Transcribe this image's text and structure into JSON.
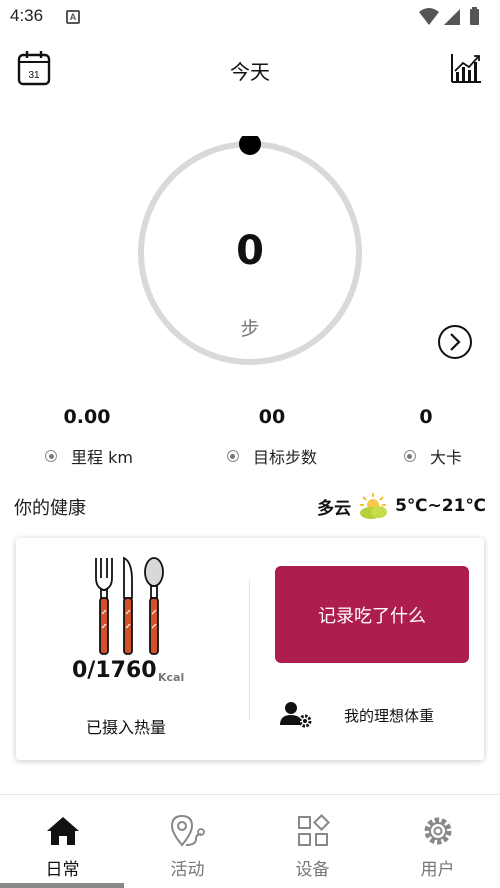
{
  "status_bar": {
    "time": "4:36",
    "notification_letter": "A"
  },
  "header": {
    "title": "今天",
    "calendar_day": "31"
  },
  "steps": {
    "value": "0",
    "unit": "步",
    "progress": 0
  },
  "stats": [
    {
      "value": "0.00",
      "label": "里程 km"
    },
    {
      "value": "00",
      "label": "目标步数"
    },
    {
      "value": "0",
      "label": "大卡"
    }
  ],
  "health": {
    "title": "你的健康"
  },
  "weather": {
    "condition": "多云",
    "temp_range": "5℃~21℃",
    "icon": "partly-cloudy-icon"
  },
  "intake": {
    "value": "0/1760",
    "unit": "Kcal",
    "label": "已摄入热量"
  },
  "actions": {
    "record_label": "记录吃了什么",
    "ideal_weight_label": "我的理想体重"
  },
  "nav": [
    {
      "label": "日常",
      "icon": "home-icon",
      "active": true
    },
    {
      "label": "活动",
      "icon": "location-icon",
      "active": false
    },
    {
      "label": "设备",
      "icon": "devices-icon",
      "active": false
    },
    {
      "label": "用户",
      "icon": "gear-icon",
      "active": false
    }
  ],
  "colors": {
    "accent": "#ad1e4c",
    "ring_track": "#d9d9d9",
    "ring_knob": "#000000",
    "cutlery_red": "#d2502a"
  }
}
